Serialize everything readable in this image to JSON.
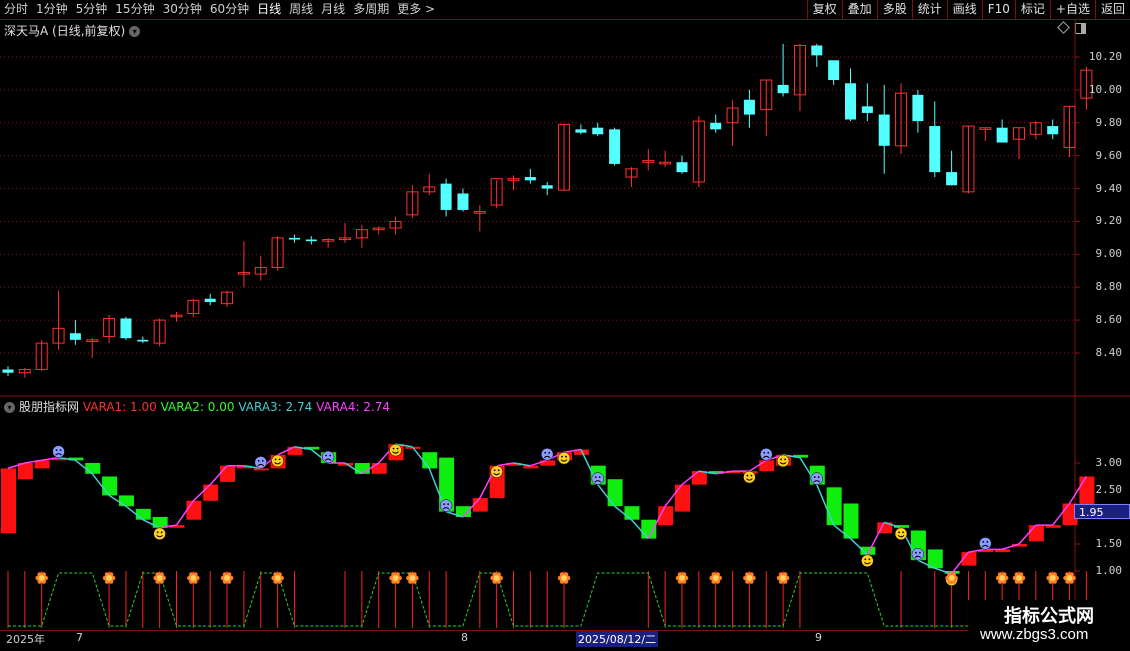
{
  "toolbar": {
    "periods": [
      "分时",
      "1分钟",
      "5分钟",
      "15分钟",
      "30分钟",
      "60分钟",
      "日线",
      "周线",
      "月线",
      "多周期",
      "更多 >"
    ],
    "active": "日线",
    "right_buttons": [
      "复权",
      "叠加",
      "多股",
      "统计",
      "画线",
      "F10",
      "标记",
      "+自选",
      "返回"
    ]
  },
  "main": {
    "title": "深天马A (日线,前复权)",
    "price_labels": [
      "10.20",
      "10.00",
      "9.80",
      "9.60",
      "9.40",
      "9.20",
      "9.00",
      "8.80",
      "8.60",
      "8.40"
    ]
  },
  "indicator": {
    "name": "股朋指标网",
    "vars": [
      {
        "label": "VARA1: 1.00",
        "color": "#ff3030"
      },
      {
        "label": "VARA2: 0.00",
        "color": "#30ff30"
      },
      {
        "label": "VARA3: 2.74",
        "color": "#40d0d0"
      },
      {
        "label": "VARA4: 2.74",
        "color": "#ff40ff"
      }
    ],
    "axis_labels": [
      "3.00",
      "2.50",
      "1.95",
      "1.50",
      "1.00"
    ],
    "current_value": "1.95"
  },
  "dates": {
    "year": "2025年",
    "m7": "7",
    "m8": "8",
    "cursor": "2025/08/12/二",
    "m9": "9"
  },
  "watermark": {
    "title": "指标公式网",
    "url": "www.zbgs3.com"
  },
  "colors": {
    "up": "#ff3030",
    "down": "#54ffff",
    "grid": "#8a1010"
  },
  "candles": [
    [
      8.3,
      8.32,
      8.26,
      8.28
    ],
    [
      8.28,
      8.31,
      8.25,
      8.3
    ],
    [
      8.3,
      8.48,
      8.29,
      8.46
    ],
    [
      8.46,
      8.78,
      8.42,
      8.55
    ],
    [
      8.52,
      8.6,
      8.45,
      8.48
    ],
    [
      8.47,
      8.49,
      8.37,
      8.48
    ],
    [
      8.5,
      8.63,
      8.46,
      8.61
    ],
    [
      8.61,
      8.62,
      8.48,
      8.49
    ],
    [
      8.48,
      8.5,
      8.46,
      8.47
    ],
    [
      8.46,
      8.61,
      8.44,
      8.6
    ],
    [
      8.62,
      8.65,
      8.59,
      8.63
    ],
    [
      8.64,
      8.73,
      8.62,
      8.72
    ],
    [
      8.73,
      8.76,
      8.69,
      8.71
    ],
    [
      8.7,
      8.78,
      8.68,
      8.77
    ],
    [
      8.88,
      9.08,
      8.8,
      8.89
    ],
    [
      8.88,
      8.99,
      8.84,
      8.92
    ],
    [
      8.92,
      9.11,
      8.9,
      9.1
    ],
    [
      9.1,
      9.12,
      9.07,
      9.09
    ],
    [
      9.09,
      9.11,
      9.06,
      9.08
    ],
    [
      9.08,
      9.1,
      9.04,
      9.09
    ],
    [
      9.09,
      9.19,
      9.07,
      9.1
    ],
    [
      9.1,
      9.18,
      9.04,
      9.15
    ],
    [
      9.15,
      9.17,
      9.12,
      9.16
    ],
    [
      9.16,
      9.23,
      9.12,
      9.2
    ],
    [
      9.24,
      9.42,
      9.22,
      9.38
    ],
    [
      9.38,
      9.49,
      9.36,
      9.41
    ],
    [
      9.43,
      9.46,
      9.23,
      9.27
    ],
    [
      9.37,
      9.4,
      9.26,
      9.27
    ],
    [
      9.25,
      9.3,
      9.14,
      9.26
    ],
    [
      9.3,
      9.45,
      9.28,
      9.46
    ],
    [
      9.45,
      9.48,
      9.39,
      9.46
    ],
    [
      9.47,
      9.52,
      9.43,
      9.45
    ],
    [
      9.42,
      9.44,
      9.36,
      9.4
    ],
    [
      9.39,
      9.79,
      9.39,
      9.79
    ],
    [
      9.76,
      9.79,
      9.73,
      9.74
    ],
    [
      9.77,
      9.8,
      9.72,
      9.73
    ],
    [
      9.76,
      9.77,
      9.54,
      9.55
    ],
    [
      9.47,
      9.53,
      9.41,
      9.52
    ],
    [
      9.56,
      9.64,
      9.51,
      9.57
    ],
    [
      9.55,
      9.63,
      9.53,
      9.56
    ],
    [
      9.56,
      9.6,
      9.49,
      9.5
    ],
    [
      9.44,
      9.84,
      9.41,
      9.81
    ],
    [
      9.8,
      9.85,
      9.74,
      9.76
    ],
    [
      9.8,
      9.94,
      9.66,
      9.89
    ],
    [
      9.94,
      10.0,
      9.77,
      9.85
    ],
    [
      9.88,
      10.06,
      9.72,
      10.06
    ],
    [
      10.03,
      10.28,
      9.96,
      9.98
    ],
    [
      9.97,
      10.28,
      9.87,
      10.27
    ],
    [
      10.27,
      10.28,
      10.14,
      10.21
    ],
    [
      10.18,
      10.16,
      10.03,
      10.06
    ],
    [
      10.04,
      10.13,
      9.81,
      9.82
    ],
    [
      9.9,
      10.04,
      9.81,
      9.86
    ],
    [
      9.85,
      10.03,
      9.49,
      9.66
    ],
    [
      9.66,
      10.04,
      9.61,
      9.98
    ],
    [
      9.97,
      10.0,
      9.74,
      9.81
    ],
    [
      9.78,
      9.93,
      9.47,
      9.5
    ],
    [
      9.5,
      9.63,
      9.42,
      9.42
    ],
    [
      9.38,
      9.78,
      9.37,
      9.78
    ],
    [
      9.76,
      9.77,
      9.69,
      9.77
    ],
    [
      9.77,
      9.82,
      9.68,
      9.68
    ],
    [
      9.7,
      9.77,
      9.58,
      9.77
    ],
    [
      9.73,
      9.81,
      9.7,
      9.8
    ],
    [
      9.78,
      9.82,
      9.7,
      9.73
    ],
    [
      9.65,
      9.9,
      9.59,
      9.9
    ],
    [
      9.95,
      10.14,
      9.88,
      10.12
    ]
  ],
  "osc": [
    [
      1.7,
      2.9
    ],
    [
      2.7,
      3.0
    ],
    [
      2.9,
      3.05
    ],
    [
      3.05,
      3.1
    ],
    [
      3.1,
      3.05
    ],
    [
      3.0,
      2.8
    ],
    [
      2.75,
      2.4
    ],
    [
      2.4,
      2.2
    ],
    [
      2.15,
      1.95
    ],
    [
      2.0,
      1.8
    ],
    [
      1.8,
      1.85
    ],
    [
      1.95,
      2.3
    ],
    [
      2.3,
      2.6
    ],
    [
      2.65,
      2.95
    ],
    [
      2.9,
      2.95
    ],
    [
      2.9,
      2.9
    ],
    [
      2.9,
      3.15
    ],
    [
      3.15,
      3.3
    ],
    [
      3.3,
      3.25
    ],
    [
      3.2,
      3.0
    ],
    [
      2.95,
      3.0
    ],
    [
      3.0,
      2.8
    ],
    [
      2.8,
      3.0
    ],
    [
      3.05,
      3.35
    ],
    [
      3.3,
      3.3
    ],
    [
      3.2,
      2.9
    ],
    [
      3.1,
      2.1
    ],
    [
      2.2,
      2.0
    ],
    [
      2.1,
      2.35
    ],
    [
      2.35,
      2.95
    ],
    [
      2.95,
      3.0
    ],
    [
      2.9,
      2.95
    ],
    [
      2.95,
      3.05
    ],
    [
      3.05,
      3.2
    ],
    [
      3.15,
      3.25
    ],
    [
      2.95,
      2.6
    ],
    [
      2.7,
      2.2
    ],
    [
      2.2,
      1.95
    ],
    [
      1.95,
      1.6
    ],
    [
      1.85,
      2.2
    ],
    [
      2.1,
      2.6
    ],
    [
      2.6,
      2.85
    ],
    [
      2.85,
      2.8
    ],
    [
      2.85,
      2.85
    ],
    [
      2.8,
      2.85
    ],
    [
      2.85,
      3.05
    ],
    [
      2.95,
      3.15
    ],
    [
      3.15,
      3.1
    ],
    [
      2.95,
      2.6
    ],
    [
      2.55,
      1.85
    ],
    [
      2.25,
      1.6
    ],
    [
      1.45,
      1.3
    ],
    [
      1.7,
      1.9
    ],
    [
      1.85,
      1.8
    ],
    [
      1.75,
      1.2
    ],
    [
      1.4,
      1.05
    ],
    [
      1.0,
      0.95
    ],
    [
      1.1,
      1.35
    ],
    [
      1.35,
      1.4
    ],
    [
      1.35,
      1.4
    ],
    [
      1.45,
      1.5
    ],
    [
      1.55,
      1.85
    ],
    [
      1.8,
      1.85
    ],
    [
      1.85,
      2.25
    ],
    [
      2.2,
      2.75
    ]
  ],
  "happy": [
    9,
    16,
    23,
    29,
    33,
    44,
    46,
    51,
    53,
    56
  ],
  "sad": [
    3,
    15,
    19,
    26,
    32,
    35,
    45,
    48,
    54,
    58
  ],
  "flowers": [
    2,
    6,
    9,
    11,
    13,
    16,
    23,
    24,
    29,
    33,
    40,
    42,
    44,
    46,
    56,
    59,
    60,
    62,
    63
  ],
  "wave_highs": [
    [
      3,
      5
    ],
    [
      8,
      9
    ],
    [
      15,
      16
    ],
    [
      22,
      24
    ],
    [
      28,
      29
    ],
    [
      35,
      38
    ],
    [
      47,
      51
    ]
  ],
  "signal_bars": [
    0,
    1,
    2,
    6,
    7,
    8,
    9,
    10,
    11,
    12,
    13,
    14,
    15,
    16,
    17,
    20,
    21,
    22,
    23,
    24,
    25,
    26,
    28,
    29,
    30,
    31,
    32,
    33,
    38,
    39,
    40,
    41,
    42,
    43,
    44,
    45,
    46,
    47,
    53,
    55,
    56,
    57,
    58,
    59,
    60,
    61,
    62,
    63,
    64
  ]
}
